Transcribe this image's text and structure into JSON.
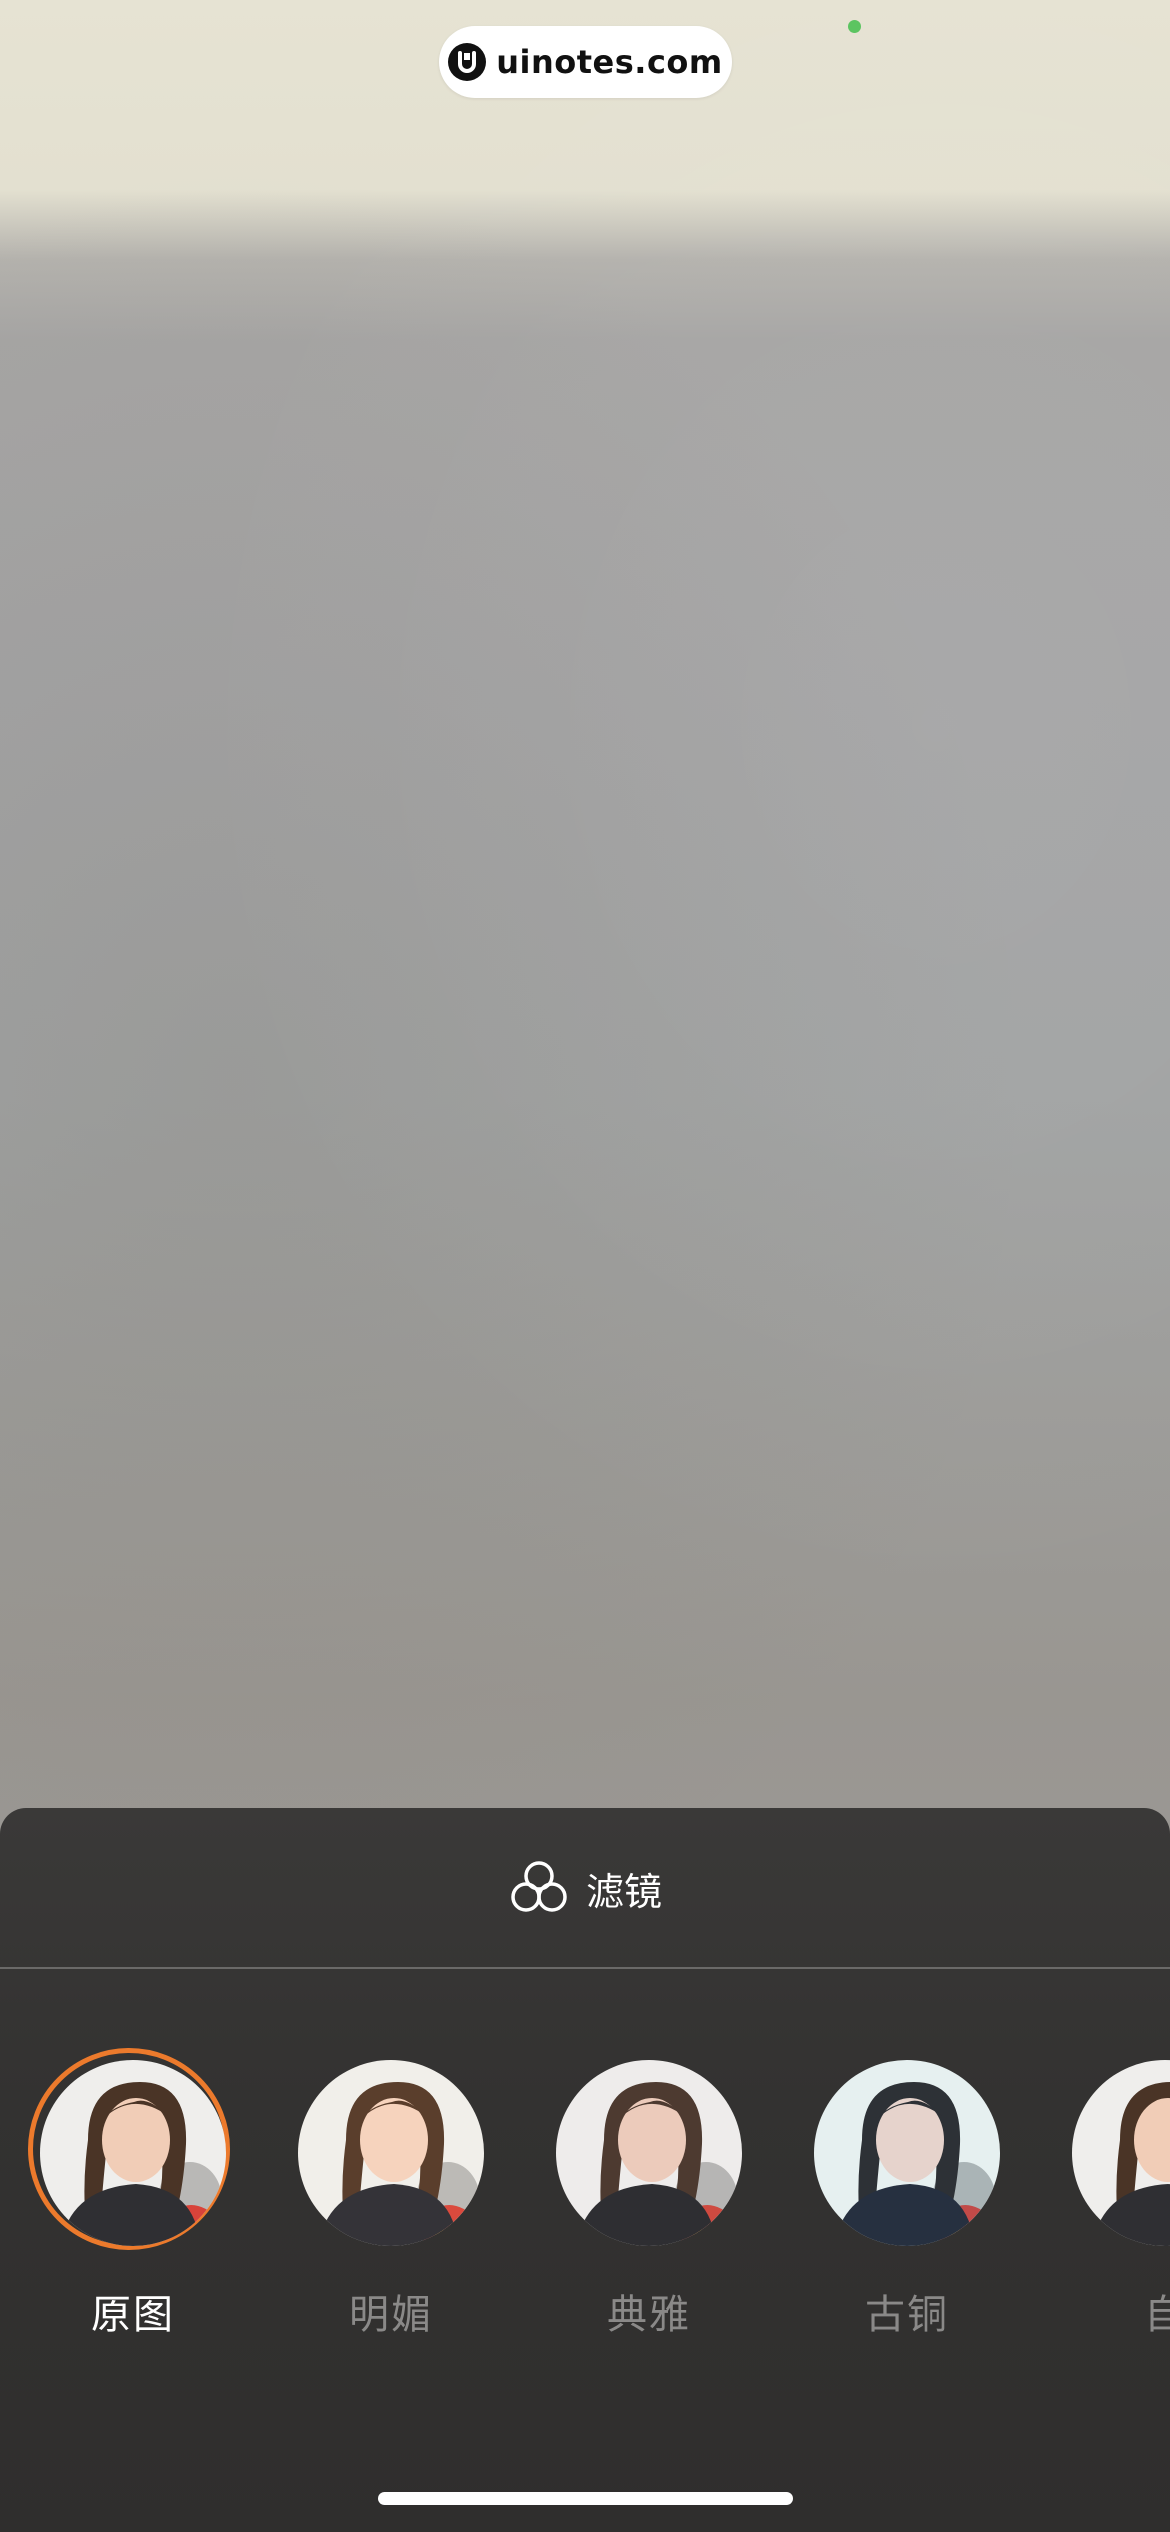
{
  "watermark": {
    "text": "uinotes.com",
    "logo_icon": "u-logo-icon"
  },
  "status": {
    "camera_indicator_color": "#5cc461"
  },
  "panel": {
    "title": "滤镜",
    "title_icon": "filter-circles-icon"
  },
  "filters": [
    {
      "label": "原图",
      "selected": true,
      "tint": "#efeeec"
    },
    {
      "label": "明媚",
      "selected": false,
      "tint": "#f1efea"
    },
    {
      "label": "典雅",
      "selected": false,
      "tint": "#eeeceb"
    },
    {
      "label": "古铜",
      "selected": false,
      "tint": "#e6f0f0"
    },
    {
      "label": "自",
      "selected": false,
      "tint": "#efeeec"
    }
  ],
  "colors": {
    "selection_ring": "#ec7a2c",
    "active_label": "#ffffff",
    "inactive_label": "#8a8988"
  }
}
